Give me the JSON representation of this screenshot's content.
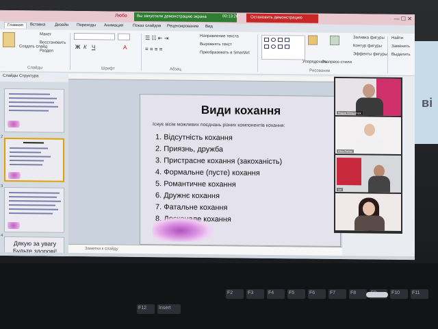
{
  "window": {
    "app_name": "Любо",
    "demo_banner": "Вы запустили демонстрацию экрана",
    "demo_time": "00:13:26",
    "stop_demo": "Остановить демонстрацию",
    "controls": "— ☐ ✕"
  },
  "ribbon_tabs": [
    "Главная",
    "Вставка",
    "Дизайн",
    "Переходы",
    "Анимация",
    "Показ слайдов",
    "Рецензирование",
    "Вид"
  ],
  "ribbon": {
    "create_slide": "Создать слайд",
    "layout": "Макет",
    "restore": "Восстановить",
    "section": "Раздел",
    "text_direction": "Направление текста",
    "align_text": "Выровнять текст",
    "convert_smartart": "Преобразовать в SmartArt",
    "arrange": "Упорядочить",
    "quick_styles": "Экспресс-стили",
    "shape_fill": "Заливка фигуры",
    "shape_outline": "Контур фигуры",
    "shape_effects": "Эффекты фигуры",
    "find": "Найти",
    "replace": "Заменить",
    "select": "Выделить",
    "group_slides": "Слайды",
    "group_font": "Шрифт",
    "group_paragraph": "Абзац",
    "group_drawing": "Рисование"
  },
  "panel": {
    "tab_slides": "Слайды",
    "tab_structure": "Структура",
    "thumb_numbers": [
      "1",
      "2",
      "3",
      "4"
    ],
    "thumb4_line1": "Дякую за увагу",
    "thumb4_line2": "Будьте здорові!"
  },
  "slide": {
    "title": "Види кохання",
    "subtitle": "Існує вісім можливих поєднань різних компонентів кохання:",
    "items": [
      "1. Відсутність кохання",
      "2. Приязнь, дружба",
      "3. Пристрасне кохання (закоханість)",
      "4. Формальне (пусте) кохання",
      "5. Романтичне кохання",
      "6. Дружнє кохання",
      "7. Фатальне кохання",
      "8. Досконале кохання"
    ]
  },
  "notes_placeholder": "Заметки к слайду",
  "video_tiles": [
    {
      "name": "Вадим Мельничук"
    },
    {
      "name": "Юля Рибак"
    },
    {
      "name": "Ізя"
    },
    {
      "name": ""
    }
  ],
  "side_text": "ві",
  "keyboard": [
    "F2",
    "F3",
    "F4",
    "F5",
    "F6",
    "F7",
    "F8",
    "F9",
    "F10",
    "F11",
    "F12",
    "Insert"
  ],
  "colors": {
    "demo_green": "#2e7d32",
    "stop_red": "#c62828",
    "taskbar": "#1f3f66",
    "thumb_selected": "#e0a000"
  }
}
